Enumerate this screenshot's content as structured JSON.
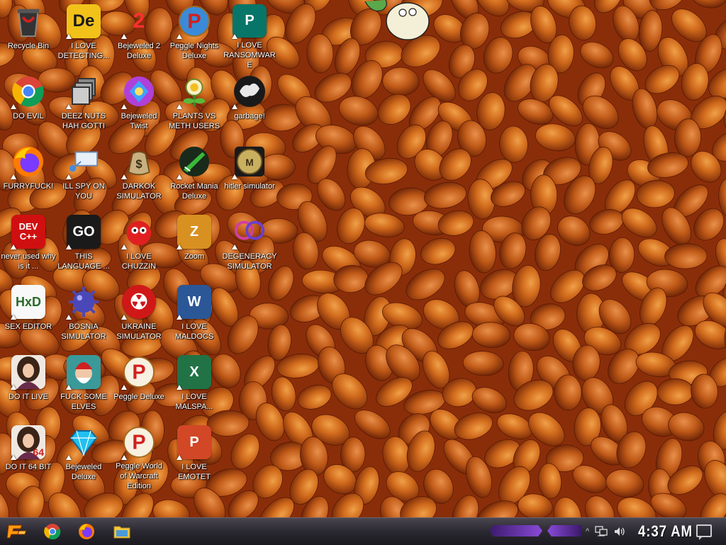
{
  "desktop": {
    "icons": [
      {
        "label": "Recycle Bin",
        "art": "bin",
        "bg": "#2a2a2a",
        "glyph": "🗑",
        "shortcut": false
      },
      {
        "label": "DO EVIL",
        "art": "chrome",
        "bg": "#ffffff",
        "glyph": "",
        "shortcut": true
      },
      {
        "label": "FURRYFUCK!",
        "art": "firefox",
        "bg": "#ff6a00",
        "glyph": "",
        "shortcut": true
      },
      {
        "label": "never used why is it ...",
        "art": "devcpp",
        "bg": "#d01010",
        "glyph": "DEV C++",
        "shortcut": true
      },
      {
        "label": "SEX EDITOR",
        "art": "hxd",
        "bg": "#f8f8f8",
        "glyph": "HxD",
        "shortcut": true
      },
      {
        "label": "DO IT LIVE",
        "art": "portrait",
        "bg": "#6a4a3a",
        "glyph": "",
        "shortcut": true
      },
      {
        "label": "DO IT 64 BIT",
        "art": "portrait64",
        "bg": "#6a4a3a",
        "glyph": "64",
        "shortcut": true
      },
      {
        "label": "I LOVE DETECTING...",
        "art": "de",
        "bg": "#f2c21a",
        "glyph": "De",
        "shortcut": true
      },
      {
        "label": "DEEZ NUTS HAH GOTTI",
        "art": "stack",
        "bg": "#c8c8c8",
        "glyph": "",
        "shortcut": true
      },
      {
        "label": "ILL SPY ON YOU",
        "art": "network",
        "bg": "#dbe8f5",
        "glyph": "",
        "shortcut": true
      },
      {
        "label": "THIS LANGUAGE ...",
        "art": "goland",
        "bg": "#1a1a1a",
        "glyph": "GO",
        "shortcut": true
      },
      {
        "label": "BOSNIA SIMULATOR",
        "art": "mine",
        "bg": "#4a48b8",
        "glyph": "",
        "shortcut": true
      },
      {
        "label": "FUCK SOME ELVES",
        "art": "santa",
        "bg": "#3a9a9a",
        "glyph": "",
        "shortcut": true
      },
      {
        "label": "Bejeweled Deluxe",
        "art": "gem",
        "bg": "#1ab0e8",
        "glyph": "",
        "shortcut": true
      },
      {
        "label": "Bejeweled 2 Deluxe",
        "art": "bej2",
        "bg": "#2a2a8a",
        "glyph": "2",
        "shortcut": true
      },
      {
        "label": "Bejeweled Twist",
        "art": "twist",
        "bg": "#b040d8",
        "glyph": "",
        "shortcut": true
      },
      {
        "label": "DARKOK SIMULATOR",
        "art": "money",
        "bg": "#c8b890",
        "glyph": "$",
        "shortcut": true
      },
      {
        "label": "I LOVE CHUZZIN",
        "art": "chuzzle",
        "bg": "#e02020",
        "glyph": "",
        "shortcut": true
      },
      {
        "label": "UKRAINE SIMULATOR",
        "art": "nuke",
        "bg": "#d01818",
        "glyph": "☢",
        "shortcut": true
      },
      {
        "label": "Peggle Deluxe",
        "art": "peggle",
        "bg": "#e8e8e8",
        "glyph": "P",
        "shortcut": true
      },
      {
        "label": "Peggle World of Warcraft Edition",
        "art": "pegglewow",
        "bg": "#e8d8b0",
        "glyph": "P",
        "shortcut": true
      },
      {
        "label": "Peggle Nights Deluxe",
        "art": "pegglen",
        "bg": "#3a8ad8",
        "glyph": "P",
        "shortcut": true
      },
      {
        "label": "PLANTS VS METH USERS",
        "art": "pvz",
        "bg": "#6aa83a",
        "glyph": "",
        "shortcut": true
      },
      {
        "label": "Rocket Mania Deluxe",
        "art": "rocket",
        "bg": "#1a3a1a",
        "glyph": "",
        "shortcut": true
      },
      {
        "label": "Zoom",
        "art": "zuma",
        "bg": "#d89020",
        "glyph": "Z",
        "shortcut": true
      },
      {
        "label": "I LOVE MALDOCS",
        "art": "word",
        "bg": "#2b5797",
        "glyph": "W",
        "shortcut": true
      },
      {
        "label": "I LOVE MALSPA...",
        "art": "excel",
        "bg": "#217346",
        "glyph": "X",
        "shortcut": true
      },
      {
        "label": "I LOVE EMOTET",
        "art": "ppt",
        "bg": "#d24726",
        "glyph": "P",
        "shortcut": true
      },
      {
        "label": "I LOVE RANSOMWARE",
        "art": "publisher",
        "bg": "#077568",
        "glyph": "P",
        "shortcut": true
      },
      {
        "label": "garbage!",
        "art": "garbage",
        "bg": "#1a1a1a",
        "glyph": "",
        "shortcut": true
      },
      {
        "label": "hitler simulator",
        "art": "coin",
        "bg": "#b09a50",
        "glyph": "",
        "shortcut": true
      },
      {
        "label": "DEGENERACY SIMULATOR",
        "art": "degen",
        "bg": "#f0e8f8",
        "glyph": "",
        "shortcut": true
      }
    ]
  },
  "taskbar": {
    "start_glyph": "꒒",
    "pinned": [
      {
        "name": "chrome",
        "color": "#ffffff"
      },
      {
        "name": "firefox",
        "color": "#ff6a00"
      },
      {
        "name": "file-explorer",
        "color": "#f5c842"
      }
    ],
    "tray": {
      "chevron": "^",
      "clock": "4:37 AM"
    }
  }
}
